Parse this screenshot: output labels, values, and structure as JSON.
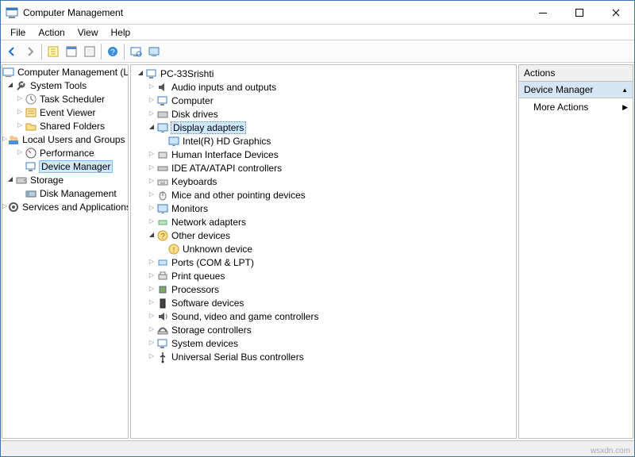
{
  "window": {
    "title": "Computer Management"
  },
  "menu": {
    "file": "File",
    "action": "Action",
    "view": "View",
    "help": "Help"
  },
  "leftTree": {
    "root": "Computer Management (Local",
    "systemTools": "System Tools",
    "taskScheduler": "Task Scheduler",
    "eventViewer": "Event Viewer",
    "sharedFolders": "Shared Folders",
    "localUsers": "Local Users and Groups",
    "performance": "Performance",
    "deviceManager": "Device Manager",
    "storage": "Storage",
    "diskMgmt": "Disk Management",
    "services": "Services and Applications"
  },
  "midTree": {
    "root": "PC-33Srishti",
    "audio": "Audio inputs and outputs",
    "computer": "Computer",
    "disk": "Disk drives",
    "display": "Display adapters",
    "displayChild": "Intel(R) HD Graphics",
    "hid": "Human Interface Devices",
    "ide": "IDE ATA/ATAPI controllers",
    "keyboards": "Keyboards",
    "mice": "Mice and other pointing devices",
    "monitors": "Monitors",
    "network": "Network adapters",
    "other": "Other devices",
    "otherChild": "Unknown device",
    "ports": "Ports (COM & LPT)",
    "printq": "Print queues",
    "proc": "Processors",
    "softdev": "Software devices",
    "sound": "Sound, video and game controllers",
    "storage": "Storage controllers",
    "sysdev": "System devices",
    "usb": "Universal Serial Bus controllers"
  },
  "actions": {
    "header": "Actions",
    "group": "Device Manager",
    "more": "More Actions"
  },
  "watermark": "wsxdn.com"
}
